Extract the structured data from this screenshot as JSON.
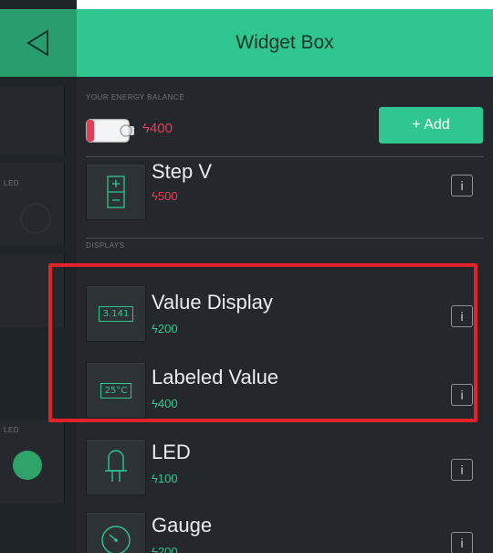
{
  "header": {
    "title": "Widget Box"
  },
  "left_strip": {
    "led_label_top": "LED",
    "led_label_bottom": "LED"
  },
  "balance": {
    "label": "YOUR ENERGY BALANCE",
    "value": "ϟ400",
    "add_label": "+ Add"
  },
  "sections": {
    "displays_label": "DISPLAYS"
  },
  "widgets": [
    {
      "name": "Step V",
      "price": "ϟ500",
      "price_color": "#e0405a",
      "icon": "step-v-icon",
      "info": "i"
    },
    {
      "name": "Value Display",
      "price": "ϟ200",
      "price_color": "#2fc690",
      "icon": "value-display-icon",
      "icon_text": "3.141",
      "info": "i"
    },
    {
      "name": "Labeled Value",
      "price": "ϟ400",
      "price_color": "#2fc690",
      "icon": "labeled-value-icon",
      "icon_text": "25°C",
      "info": "i"
    },
    {
      "name": "LED",
      "price": "ϟ100",
      "price_color": "#2fc690",
      "icon": "led-icon",
      "info": "i"
    },
    {
      "name": "Gauge",
      "price": "ϟ200",
      "price_color": "#2fc690",
      "icon": "gauge-icon",
      "info": "i"
    }
  ],
  "colors": {
    "accent": "#2fc690",
    "danger": "#e0405a",
    "highlight": "#e0222a"
  }
}
